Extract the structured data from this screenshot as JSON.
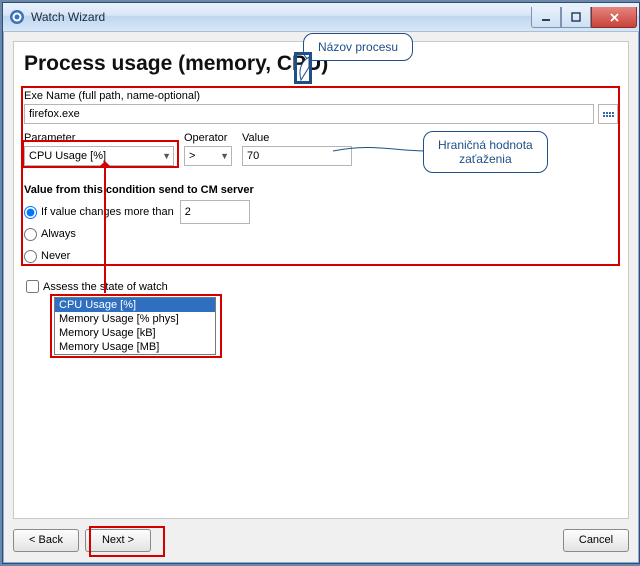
{
  "window": {
    "title": "Watch Wizard"
  },
  "header": {
    "title": "Process usage (memory, CPU)"
  },
  "callouts": {
    "name": "Názov procesu",
    "threshold_line1": "Hraničná hodnota",
    "threshold_line2": "zaťaženia"
  },
  "form": {
    "exe_label": "Exe Name (full path, name-optional)",
    "exe_value": "firefox.exe",
    "parameter_label": "Parameter",
    "parameter_value": "CPU Usage [%]",
    "operator_label": "Operator",
    "operator_value": ">",
    "value_label": "Value",
    "value_value": "70"
  },
  "condition": {
    "group_title": "Value from this condition send to CM server",
    "opt_changes": "If value changes more than",
    "changes_value": "2",
    "opt_always": "Always",
    "opt_never": "Never"
  },
  "assess": {
    "label": "Assess the state of watch"
  },
  "dropdown": {
    "items": [
      "CPU Usage [%]",
      "Memory Usage [% phys]",
      "Memory Usage [kB]",
      "Memory Usage [MB]"
    ]
  },
  "buttons": {
    "back": "< Back",
    "next": "Next >",
    "cancel": "Cancel"
  }
}
